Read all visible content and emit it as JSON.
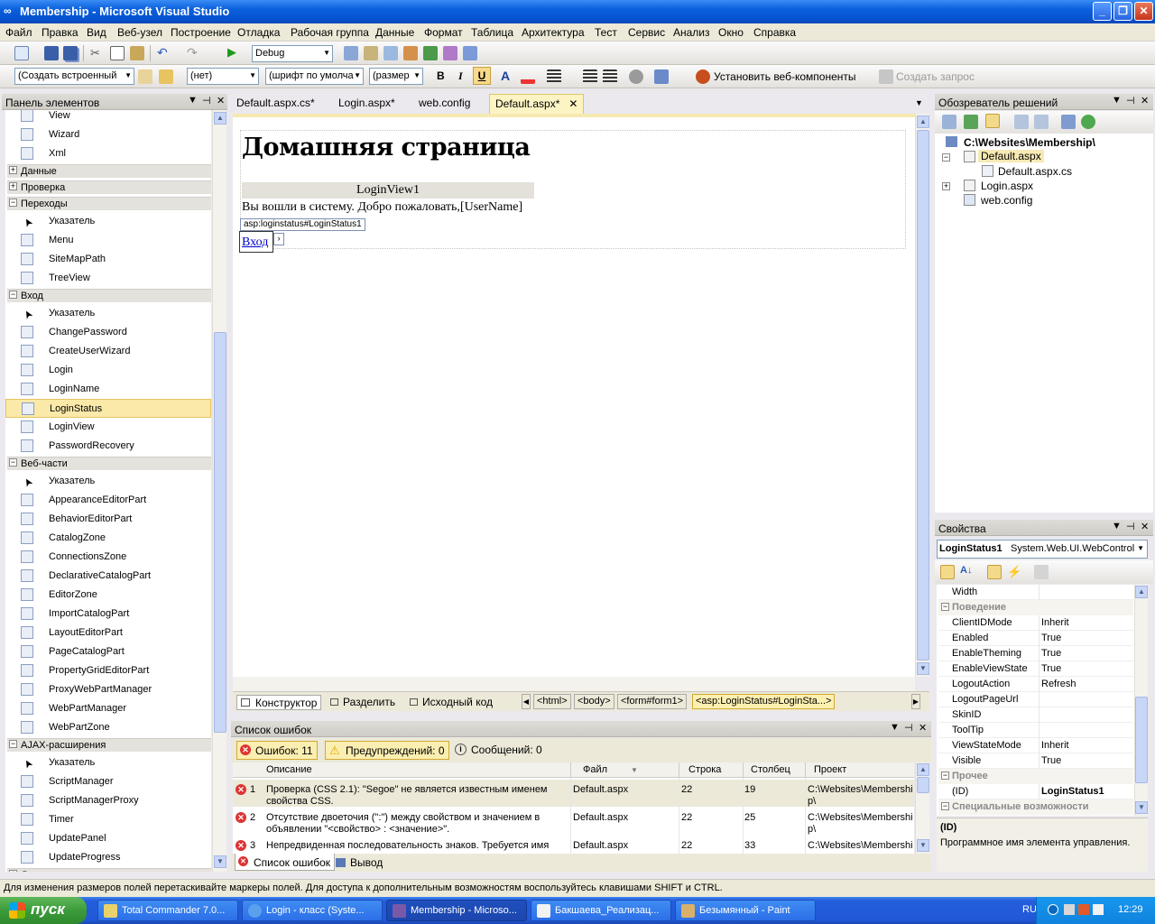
{
  "window": {
    "title": "Membership - Microsoft Visual Studio"
  },
  "menu": [
    "Файл",
    "Правка",
    "Вид",
    "Веб-узел",
    "Построение",
    "Отладка",
    "Рабочая группа",
    "Данные",
    "Формат",
    "Таблица",
    "Архитектура",
    "Тест",
    "Сервис",
    "Анализ",
    "Окно",
    "Справка"
  ],
  "toolbar1": {
    "config": "Debug"
  },
  "toolbar2": {
    "style_combo": "(Создать встроенный",
    "target_combo": "(нет)",
    "font_combo": "(шрифт по умолча",
    "size_combo": "(размер",
    "bold": "B",
    "italic": "I",
    "underline": "U",
    "install_web": "Установить веб-компоненты",
    "create_query": "Создать запрос"
  },
  "toolbox": {
    "title": "Панель элементов",
    "entries": [
      {
        "kind": "item",
        "label": "View",
        "icon": "view-icon"
      },
      {
        "kind": "item",
        "label": "Wizard",
        "icon": "wizard-icon"
      },
      {
        "kind": "item",
        "label": "Xml",
        "icon": "xml-icon"
      },
      {
        "kind": "group",
        "label": "Данные",
        "state": "+"
      },
      {
        "kind": "group",
        "label": "Проверка",
        "state": "+"
      },
      {
        "kind": "group",
        "label": "Переходы",
        "state": "-"
      },
      {
        "kind": "item",
        "label": "Указатель",
        "icon": "pointer-icon"
      },
      {
        "kind": "item",
        "label": "Menu",
        "icon": "menu-icon"
      },
      {
        "kind": "item",
        "label": "SiteMapPath",
        "icon": "sitemappath-icon"
      },
      {
        "kind": "item",
        "label": "TreeView",
        "icon": "treeview-icon"
      },
      {
        "kind": "group",
        "label": "Вход",
        "state": "-"
      },
      {
        "kind": "item",
        "label": "Указатель",
        "icon": "pointer-icon"
      },
      {
        "kind": "item",
        "label": "ChangePassword",
        "icon": "changepassword-icon"
      },
      {
        "kind": "item",
        "label": "CreateUserWizard",
        "icon": "createuserwizard-icon"
      },
      {
        "kind": "item",
        "label": "Login",
        "icon": "login-icon"
      },
      {
        "kind": "item",
        "label": "LoginName",
        "icon": "loginname-icon"
      },
      {
        "kind": "item",
        "label": "LoginStatus",
        "icon": "loginstatus-icon",
        "selected": true
      },
      {
        "kind": "item",
        "label": "LoginView",
        "icon": "loginview-icon"
      },
      {
        "kind": "item",
        "label": "PasswordRecovery",
        "icon": "passwordrecovery-icon"
      },
      {
        "kind": "group",
        "label": "Веб-части",
        "state": "-"
      },
      {
        "kind": "item",
        "label": "Указатель",
        "icon": "pointer-icon"
      },
      {
        "kind": "item",
        "label": "AppearanceEditorPart",
        "icon": "editorpart-icon"
      },
      {
        "kind": "item",
        "label": "BehaviorEditorPart",
        "icon": "editorpart-icon"
      },
      {
        "kind": "item",
        "label": "CatalogZone",
        "icon": "zone-icon"
      },
      {
        "kind": "item",
        "label": "ConnectionsZone",
        "icon": "connections-icon"
      },
      {
        "kind": "item",
        "label": "DeclarativeCatalogPart",
        "icon": "catalogpart-icon"
      },
      {
        "kind": "item",
        "label": "EditorZone",
        "icon": "zone-icon"
      },
      {
        "kind": "item",
        "label": "ImportCatalogPart",
        "icon": "catalogpart-icon"
      },
      {
        "kind": "item",
        "label": "LayoutEditorPart",
        "icon": "editorpart-icon"
      },
      {
        "kind": "item",
        "label": "PageCatalogPart",
        "icon": "catalogpart-icon"
      },
      {
        "kind": "item",
        "label": "PropertyGridEditorPart",
        "icon": "editorpart-icon"
      },
      {
        "kind": "item",
        "label": "ProxyWebPartManager",
        "icon": "manager-icon"
      },
      {
        "kind": "item",
        "label": "WebPartManager",
        "icon": "manager-icon"
      },
      {
        "kind": "item",
        "label": "WebPartZone",
        "icon": "zone-icon"
      },
      {
        "kind": "group",
        "label": "AJAX-расширения",
        "state": "-"
      },
      {
        "kind": "item",
        "label": "Указатель",
        "icon": "pointer-icon"
      },
      {
        "kind": "item",
        "label": "ScriptManager",
        "icon": "scriptmanager-icon"
      },
      {
        "kind": "item",
        "label": "ScriptManagerProxy",
        "icon": "scriptmanager-icon"
      },
      {
        "kind": "item",
        "label": "Timer",
        "icon": "timer-icon"
      },
      {
        "kind": "item",
        "label": "UpdatePanel",
        "icon": "updatepanel-icon"
      },
      {
        "kind": "item",
        "label": "UpdateProgress",
        "icon": "updateprogress-icon"
      },
      {
        "kind": "group",
        "label": "Динамические данные",
        "state": "+"
      }
    ]
  },
  "doc_tabs": [
    "Default.aspx.cs*",
    "Login.aspx*",
    "web.config",
    "Default.aspx*"
  ],
  "design": {
    "heading": "Домашняя страница",
    "loginview_label": "LoginView1",
    "welcome": "Вы вошли в систему. Добро пожаловать,",
    "username": "[UserName]",
    "status_tag": "asp:loginstatus#LoginStatus1",
    "status_link": "Вход"
  },
  "view_tabs": {
    "designer": "Конструктор",
    "split": "Разделить",
    "source": "Исходный код"
  },
  "breadcrumb": [
    "<html>",
    "<body>",
    "<form#form1>",
    "<asp:LoginStatus#LoginSta...>"
  ],
  "errors": {
    "title": "Список ошибок",
    "filters": {
      "errors": "Ошибок: 11",
      "warnings": "Предупреждений: 0",
      "messages": "Сообщений: 0"
    },
    "columns": {
      "desc": "Описание",
      "file": "Файл",
      "line": "Строка",
      "col": "Столбец",
      "project": "Проект"
    },
    "rows": [
      {
        "n": "1",
        "desc1": "Проверка (CSS 2.1): \"Segoe\" не является известным именем",
        "desc2": "свойства CSS.",
        "file": "Default.aspx",
        "line": "22",
        "col": "19",
        "p1": "C:\\Websites\\Membershi",
        "p2": "p\\"
      },
      {
        "n": "2",
        "desc1": "Отсутствие двоеточия (\":\") между свойством и значением в",
        "desc2": "объявлении \"<свойство> : <значение>\".",
        "file": "Default.aspx",
        "line": "22",
        "col": "25",
        "p1": "C:\\Websites\\Membershi",
        "p2": "p\\"
      },
      {
        "n": "3",
        "desc1": "Непредвиденная последовательность знаков. Требуется имя",
        "desc2": "",
        "file": "Default.aspx",
        "line": "22",
        "col": "33",
        "p1": "C:\\Websites\\Membershi",
        "p2": ""
      }
    ],
    "bottom_tabs": {
      "errors": "Список ошибок",
      "output": "Вывод"
    }
  },
  "solution": {
    "title": "Обозреватель решений",
    "root": "C:\\Websites\\Membership\\",
    "items": [
      "Default.aspx",
      "Default.aspx.cs",
      "Login.aspx",
      "web.config"
    ]
  },
  "properties": {
    "title": "Свойства",
    "object_name": "LoginStatus1",
    "object_type": "System.Web.UI.WebControl",
    "rows_top": [
      {
        "name": "Width",
        "value": ""
      }
    ],
    "cat_behavior": "Поведение",
    "rows_behavior": [
      {
        "name": "ClientIDMode",
        "value": "Inherit"
      },
      {
        "name": "Enabled",
        "value": "True"
      },
      {
        "name": "EnableTheming",
        "value": "True"
      },
      {
        "name": "EnableViewState",
        "value": "True"
      },
      {
        "name": "LogoutAction",
        "value": "Refresh"
      },
      {
        "name": "LogoutPageUrl",
        "value": ""
      },
      {
        "name": "SkinID",
        "value": ""
      },
      {
        "name": "ToolTip",
        "value": ""
      },
      {
        "name": "ViewStateMode",
        "value": "Inherit"
      },
      {
        "name": "Visible",
        "value": "True"
      }
    ],
    "cat_other": "Прочее",
    "id_name": "(ID)",
    "id_value": "LoginStatus1",
    "cat_access": "Специальные возможности",
    "desc_title": "(ID)",
    "desc_text": "Программное имя элемента управления."
  },
  "statusbar": "Для изменения размеров полей перетаскивайте маркеры полей. Для доступа к дополнительным возможностям воспользуйтесь клавишами SHIFT и CTRL.",
  "taskbar": {
    "start": "пуск",
    "tasks": [
      "Total Commander 7.0...",
      "Login - класс (Syste...",
      "Membership - Microso...",
      "Бакшаева_Реализац...",
      "Безымянный - Paint"
    ],
    "lang": "RU",
    "clock": "12:29"
  }
}
